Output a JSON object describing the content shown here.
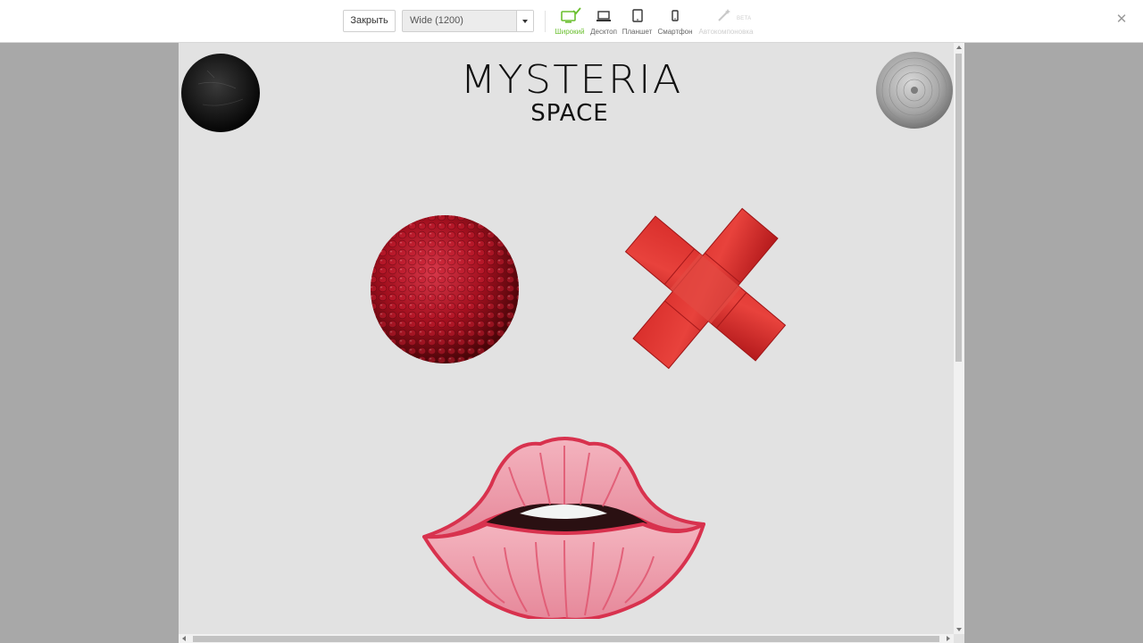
{
  "toolbar": {
    "close_label": "Закрыть",
    "size_select": {
      "value": "Wide (1200)"
    },
    "devices": [
      {
        "label": "Широкий",
        "state": "active",
        "icon": "monitor-icon"
      },
      {
        "label": "Десктоп",
        "state": "normal",
        "icon": "laptop-icon"
      },
      {
        "label": "Планшет",
        "state": "normal",
        "icon": "tablet-icon"
      },
      {
        "label": "Смартфон",
        "state": "normal",
        "icon": "smartphone-icon"
      },
      {
        "label": "Автокомпоновка",
        "state": "disabled",
        "icon": "magic-wand-icon"
      }
    ],
    "beta_badge": "BETA",
    "exit_icon": "close-icon"
  },
  "preview": {
    "logo": {
      "line1": "MYSTERIA",
      "line2": "SPACE"
    },
    "images": [
      "black-vinyl-circle",
      "silver-vinyl-circle",
      "pomegranate-ball",
      "red-cross",
      "red-lips"
    ]
  },
  "colors": {
    "accent_green": "#6abf2f",
    "canvas_bg": "#e2e2e2",
    "outer_bg": "#a8a8a8",
    "fruit_red": "#b5142a",
    "lip_pink": "#e0586e"
  }
}
